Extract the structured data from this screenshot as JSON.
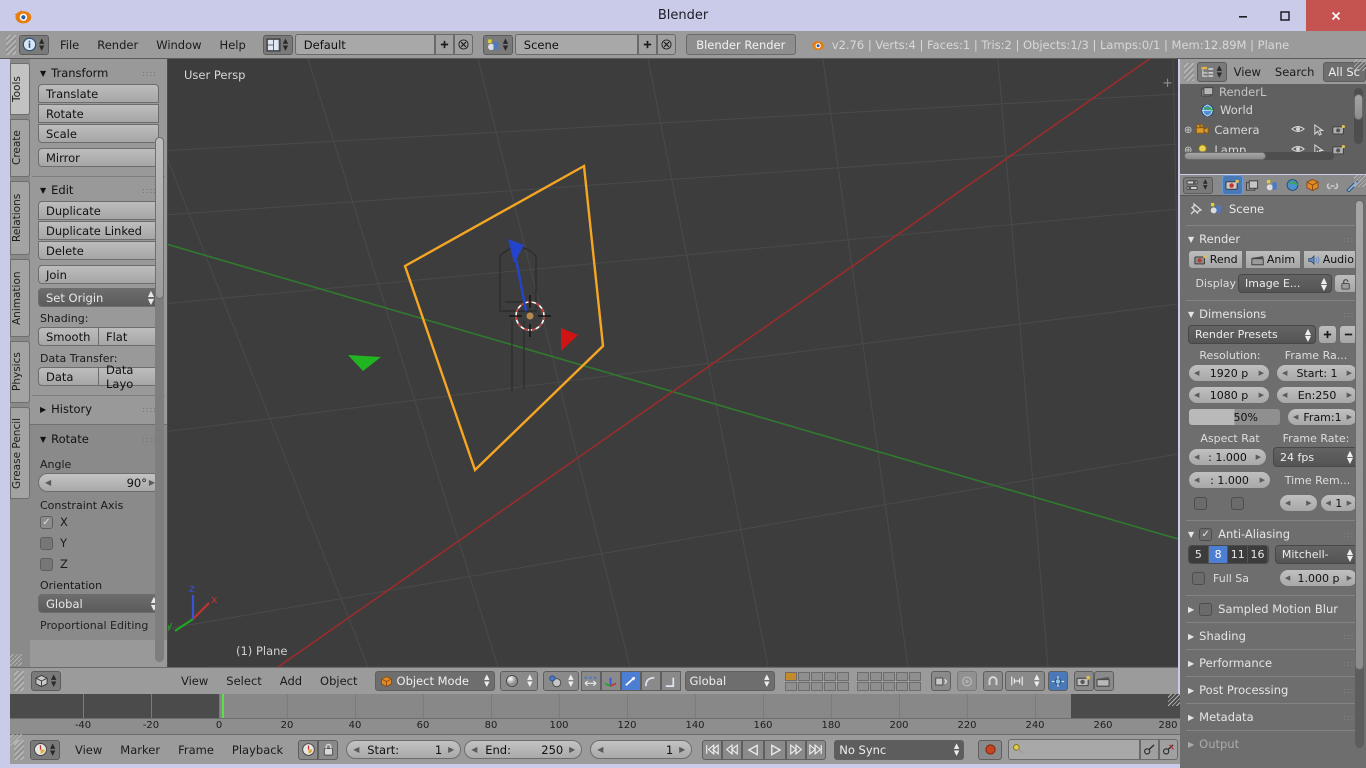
{
  "window": {
    "title": "Blender",
    "minimize": "—",
    "maximize": "☐",
    "close": "✕"
  },
  "info_header": {
    "menus": [
      "File",
      "Render",
      "Window",
      "Help"
    ],
    "screen_layout": "Default",
    "scene_name": "Scene",
    "render_engine": "Blender Render",
    "status": "v2.76 | Verts:4 | Faces:1 | Tris:2 | Objects:1/3 | Lamps:0/1 | Mem:12.89M | Plane",
    "add_icon": "+",
    "remove_icon": "✕"
  },
  "toolshelf": {
    "tabs": [
      "Tools",
      "Create",
      "Relations",
      "Animation",
      "Physics",
      "Grease Pencil"
    ],
    "active_tab": "Tools",
    "panels": [
      {
        "title": "Transform",
        "buttons": [
          "Translate",
          "Rotate",
          "Scale"
        ],
        "extra_buttons": [
          "Mirror"
        ]
      },
      {
        "title": "Edit",
        "buttons": [
          "Duplicate",
          "Duplicate Linked",
          "Delete"
        ],
        "join_button": "Join",
        "set_origin": "Set Origin",
        "shading_label": "Shading:",
        "shading_buttons": [
          "Smooth",
          "Flat"
        ],
        "data_transfer_label": "Data Transfer:",
        "data_buttons": [
          "Data",
          "Data Layo"
        ]
      },
      {
        "title": "History"
      }
    ]
  },
  "operator_panel": {
    "title": "Rotate",
    "angle_label": "Angle",
    "angle_value": "90°",
    "constraint_label": "Constraint Axis",
    "axes": [
      {
        "label": "X",
        "checked": true
      },
      {
        "label": "Y",
        "checked": false
      },
      {
        "label": "Z",
        "checked": false
      }
    ],
    "orientation_label": "Orientation",
    "orientation_value": "Global",
    "proportional_label": "Proportional Editing"
  },
  "viewport": {
    "view_label": "User Persp",
    "object_label": "(1) Plane",
    "gizmo_axes": [
      "x",
      "y",
      "z"
    ],
    "background_color": "#3d3d3d",
    "selection_color": "#f5a623",
    "axis_x_color": "#9c2b2b",
    "axis_y_color": "#2f7a2f"
  },
  "viewport_header": {
    "menus": [
      "View",
      "Select",
      "Add",
      "Object"
    ],
    "mode": "Object Mode",
    "transform_orientation": "Global",
    "editor_icon": "cube-icon",
    "shading_icon": "sphere-icon",
    "pivot_icon": "pivot-icon",
    "snap_icon": "magnet-icon",
    "layers_rows": 2,
    "layers_cols": 5,
    "active_layer_index": 0
  },
  "timeline": {
    "ticks": [
      -40,
      -20,
      0,
      20,
      40,
      60,
      80,
      100,
      120,
      140,
      160,
      180,
      200,
      220,
      240,
      260,
      280
    ],
    "range_start": -50,
    "range_end": 285,
    "playhead_frame": 1,
    "frame_start_out": 0,
    "frame_end_out": 250,
    "menus": [
      "View",
      "Marker",
      "Frame",
      "Playback"
    ],
    "start_label": "Start:",
    "start_value": "1",
    "end_label": "End:",
    "end_value": "250",
    "current_frame": "1",
    "sync_mode": "No Sync",
    "playhead_color": "#5ae04a",
    "transport": [
      "jump-start-icon",
      "prev-keyframe-icon",
      "play-reverse-icon",
      "play-icon",
      "next-keyframe-icon",
      "jump-end-icon"
    ]
  },
  "outliner": {
    "menus": [
      "View",
      "Search"
    ],
    "display_mode": "All Sc",
    "rows": [
      {
        "label": "RenderL",
        "icon": "renderlayer-icon",
        "indent": 1
      },
      {
        "label": "World",
        "icon": "world-icon",
        "indent": 1
      },
      {
        "label": "Camera",
        "icon": "camera-icon",
        "indent": 0
      },
      {
        "label": "Lamp",
        "icon": "lamp-icon",
        "indent": 0
      }
    ]
  },
  "properties": {
    "tabs": [
      "render-icon",
      "renderlayers-icon",
      "scene-icon",
      "world-icon",
      "object-icon",
      "constraints-icon",
      "modifiers-icon"
    ],
    "active_tab_index": 0,
    "breadcrumb": "Scene",
    "panels": [
      {
        "title": "Render"
      },
      {
        "title": "Dimensions"
      },
      {
        "title": "Anti-Aliasing"
      },
      {
        "title": "Sampled Motion Blur"
      },
      {
        "title": "Shading"
      },
      {
        "title": "Performance"
      },
      {
        "title": "Post Processing"
      },
      {
        "title": "Metadata"
      },
      {
        "title": "Output"
      }
    ],
    "render": {
      "buttons": [
        "Rend",
        "Anim",
        "Audio"
      ],
      "display_label": "Display",
      "display_value": "Image E..."
    },
    "dimensions": {
      "presets_label": "Render Presets",
      "resolution_label": "Resolution:",
      "resolution_x": "1920 p",
      "resolution_y": "1080 p",
      "resolution_pct": "50%",
      "frame_range_label": "Frame Ra...",
      "frame_start": "Start: 1",
      "frame_end": "En:250",
      "frame_step": "Fram:1",
      "aspect_label": "Aspect Rat",
      "aspect_x": ": 1.000",
      "aspect_y": ": 1.000",
      "frame_rate_label": "Frame Rate:",
      "frame_rate": "24 fps",
      "time_remap_label": "Time Rem...",
      "time_remap_old": "",
      "time_remap_new": "1"
    },
    "antialiasing": {
      "enabled": true,
      "samples": [
        "5",
        "8",
        "11",
        "16"
      ],
      "selected_sample": "8",
      "filter": "Mitchell-",
      "full_sample_label": "Full Sa",
      "filter_size": "1.000 p"
    }
  }
}
